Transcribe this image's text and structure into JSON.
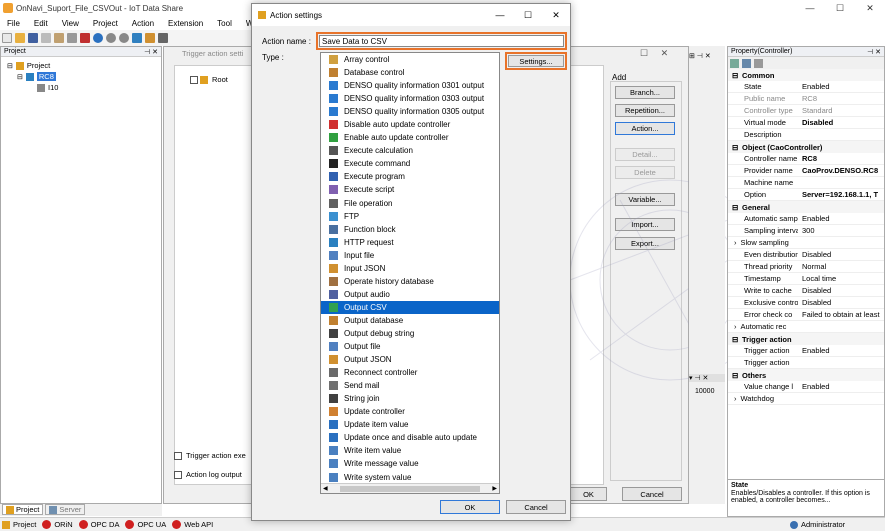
{
  "app": {
    "title": "OnNavi_Suport_File_CSVOut - IoT Data Share",
    "window_buttons": [
      "—",
      "☐",
      "✕"
    ]
  },
  "menu": [
    "File",
    "Edit",
    "View",
    "Project",
    "Action",
    "Extension",
    "Tool",
    "W"
  ],
  "project_panel": {
    "title": "Project",
    "tree": [
      "Project",
      "RC8",
      "I10"
    ],
    "tabs": [
      "Project",
      "Server"
    ]
  },
  "statusbar": {
    "items": [
      "Project",
      "ORiN",
      "OPC DA",
      "OPC UA",
      "Web API"
    ],
    "user": "Administrator"
  },
  "trigger_panel": {
    "title": "Trigger action setti",
    "root_label": "Root",
    "add_label": "Add",
    "buttons": [
      "Branch...",
      "Repetition...",
      "Action...",
      "Detail...",
      "Delete",
      "Variable...",
      "Import...",
      "Export..."
    ],
    "checkbox_exec": "Trigger action exe",
    "checkbox_log": "Action log output",
    "ok": "OK",
    "cancel": "Cancel",
    "partial_value": "10000"
  },
  "properties": {
    "title": "Property(Controller)",
    "common_title": "Common",
    "common": [
      {
        "k": "State",
        "v": "Enabled"
      },
      {
        "k": "Public name",
        "v": "RC8"
      },
      {
        "k": "Controller type",
        "v": "Standard"
      },
      {
        "k": "Virtual mode",
        "v": "Disabled"
      },
      {
        "k": "Description",
        "v": ""
      }
    ],
    "object_title": "Object (CaoController)",
    "object": [
      {
        "k": "Controller name",
        "v": "RC8"
      },
      {
        "k": "Provider name",
        "v": "CaoProv.DENSO.RC8"
      },
      {
        "k": "Machine name",
        "v": ""
      },
      {
        "k": "Option",
        "v": "Server=192.168.1.1, T"
      }
    ],
    "general_title": "General",
    "general": [
      {
        "k": "Automatic sampling",
        "v": "Enabled"
      },
      {
        "k": "Sampling interval",
        "v": "300"
      }
    ],
    "slow_sampling": "Slow sampling",
    "general2": [
      {
        "k": "Even distribution",
        "v": "Disabled"
      },
      {
        "k": "Thread priority",
        "v": "Normal"
      },
      {
        "k": "Timestamp",
        "v": "Local time"
      },
      {
        "k": "Write to cache",
        "v": "Disabled"
      },
      {
        "k": "Exclusive control",
        "v": "Disabled"
      },
      {
        "k": "Error check co",
        "v": "Failed to obtain at least"
      }
    ],
    "automatic_rec": "Automatic rec",
    "trigger_title": "Trigger action",
    "trigger": [
      {
        "k": "Trigger action",
        "v": "Enabled"
      },
      {
        "k": "Trigger action",
        "v": ""
      }
    ],
    "others_title": "Others",
    "others": [
      {
        "k": "Value change l",
        "v": "Enabled"
      }
    ],
    "watchdog": "Watchdog",
    "desc_title": "State",
    "desc_text": "Enables/Disables a controller. If this option is enabled, a controller becomes..."
  },
  "dialog": {
    "title": "Action settings",
    "action_name_label": "Action name :",
    "action_name_value": "Save Data to CSV",
    "type_label": "Type :",
    "settings_button": "Settings...",
    "ok": "OK",
    "cancel": "Cancel",
    "selected_index": 19,
    "types": [
      {
        "label": "Array control",
        "icon": "array-icon",
        "color": "#d0a040"
      },
      {
        "label": "Database control",
        "icon": "database-icon",
        "color": "#c08030"
      },
      {
        "label": "DENSO quality information 0301 output",
        "icon": "gear-icon",
        "color": "#2a7ad0"
      },
      {
        "label": "DENSO quality information 0303 output",
        "icon": "gear-icon",
        "color": "#2a7ad0"
      },
      {
        "label": "DENSO quality information 0305 output",
        "icon": "gear-icon",
        "color": "#2a7ad0"
      },
      {
        "label": "Disable auto update controller",
        "icon": "disable-icon",
        "color": "#d03030"
      },
      {
        "label": "Enable auto update controller",
        "icon": "refresh-icon",
        "color": "#30a040"
      },
      {
        "label": "Execute calculation",
        "icon": "calculator-icon",
        "color": "#555555"
      },
      {
        "label": "Execute command",
        "icon": "terminal-icon",
        "color": "#222222"
      },
      {
        "label": "Execute program",
        "icon": "program-icon",
        "color": "#3060b0"
      },
      {
        "label": "Execute script",
        "icon": "script-icon",
        "color": "#8060b0"
      },
      {
        "label": "File operation",
        "icon": "file-search-icon",
        "color": "#606060"
      },
      {
        "label": "FTP",
        "icon": "ftp-icon",
        "color": "#3a90d0"
      },
      {
        "label": "Function block",
        "icon": "function-block-icon",
        "color": "#4a70a0"
      },
      {
        "label": "HTTP request",
        "icon": "globe-icon",
        "color": "#2a80c0"
      },
      {
        "label": "Input file",
        "icon": "input-file-icon",
        "color": "#5080c0"
      },
      {
        "label": "Input JSON",
        "icon": "json-icon",
        "color": "#d09030"
      },
      {
        "label": "Operate history database",
        "icon": "history-db-icon",
        "color": "#a07040"
      },
      {
        "label": "Output audio",
        "icon": "speaker-icon",
        "color": "#5060a0"
      },
      {
        "label": "Output CSV",
        "icon": "csv-icon",
        "color": "#30a050"
      },
      {
        "label": "Output database",
        "icon": "database-output-icon",
        "color": "#c08030"
      },
      {
        "label": "Output debug string",
        "icon": "debug-icon",
        "color": "#404040"
      },
      {
        "label": "Output file",
        "icon": "output-file-icon",
        "color": "#5080c0"
      },
      {
        "label": "Output JSON",
        "icon": "json-output-icon",
        "color": "#d09030"
      },
      {
        "label": "Reconnect controller",
        "icon": "reconnect-icon",
        "color": "#6a6a6a"
      },
      {
        "label": "Send mail",
        "icon": "mail-icon",
        "color": "#707070"
      },
      {
        "label": "String join",
        "icon": "string-join-icon",
        "color": "#404040"
      },
      {
        "label": "Update controller",
        "icon": "update-controller-icon",
        "color": "#d08030"
      },
      {
        "label": "Update item value",
        "icon": "update-item-icon",
        "color": "#2a70c0"
      },
      {
        "label": "Update once and disable auto update",
        "icon": "info-icon",
        "color": "#2a70c0"
      },
      {
        "label": "Write item value",
        "icon": "write-item-icon",
        "color": "#4a80c0"
      },
      {
        "label": "Write message value",
        "icon": "write-message-icon",
        "color": "#4a80c0"
      },
      {
        "label": "Write system value",
        "icon": "write-system-icon",
        "color": "#4a80c0"
      }
    ]
  },
  "accent_color": "#e8732a"
}
